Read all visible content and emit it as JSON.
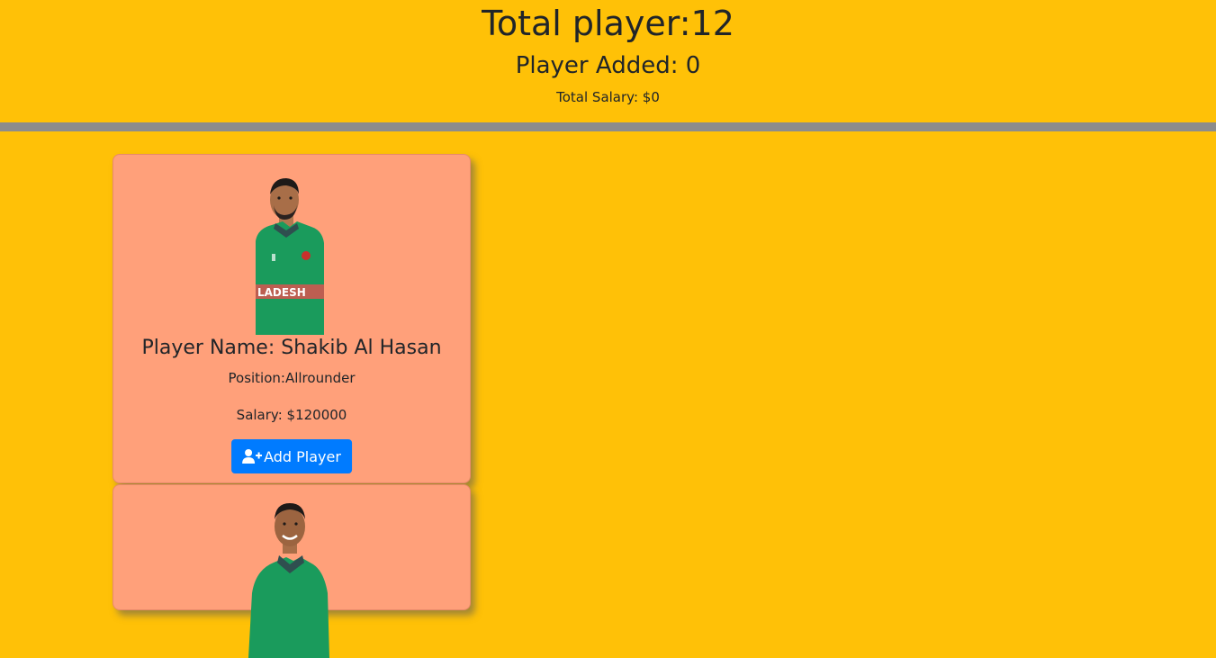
{
  "header": {
    "total_player": "Total player:12",
    "player_added": "Player Added: 0",
    "total_salary": "Total Salary: $0"
  },
  "players": [
    {
      "name": "Player Name: Shakib Al Hasan",
      "position": "Position:Allrounder",
      "salary": "Salary: $120000",
      "button_label": "Add Player",
      "button_icon": "user-plus-icon",
      "jersey_text": "LADESH"
    },
    {
      "name": "",
      "position": "",
      "salary": "",
      "button_label": "",
      "button_icon": "user-plus-icon"
    }
  ],
  "colors": {
    "background": "#ffc107",
    "card": "#ffa07a",
    "divider": "#8c8c8c",
    "button": "#007bff",
    "jersey": "#1a9b5c"
  }
}
